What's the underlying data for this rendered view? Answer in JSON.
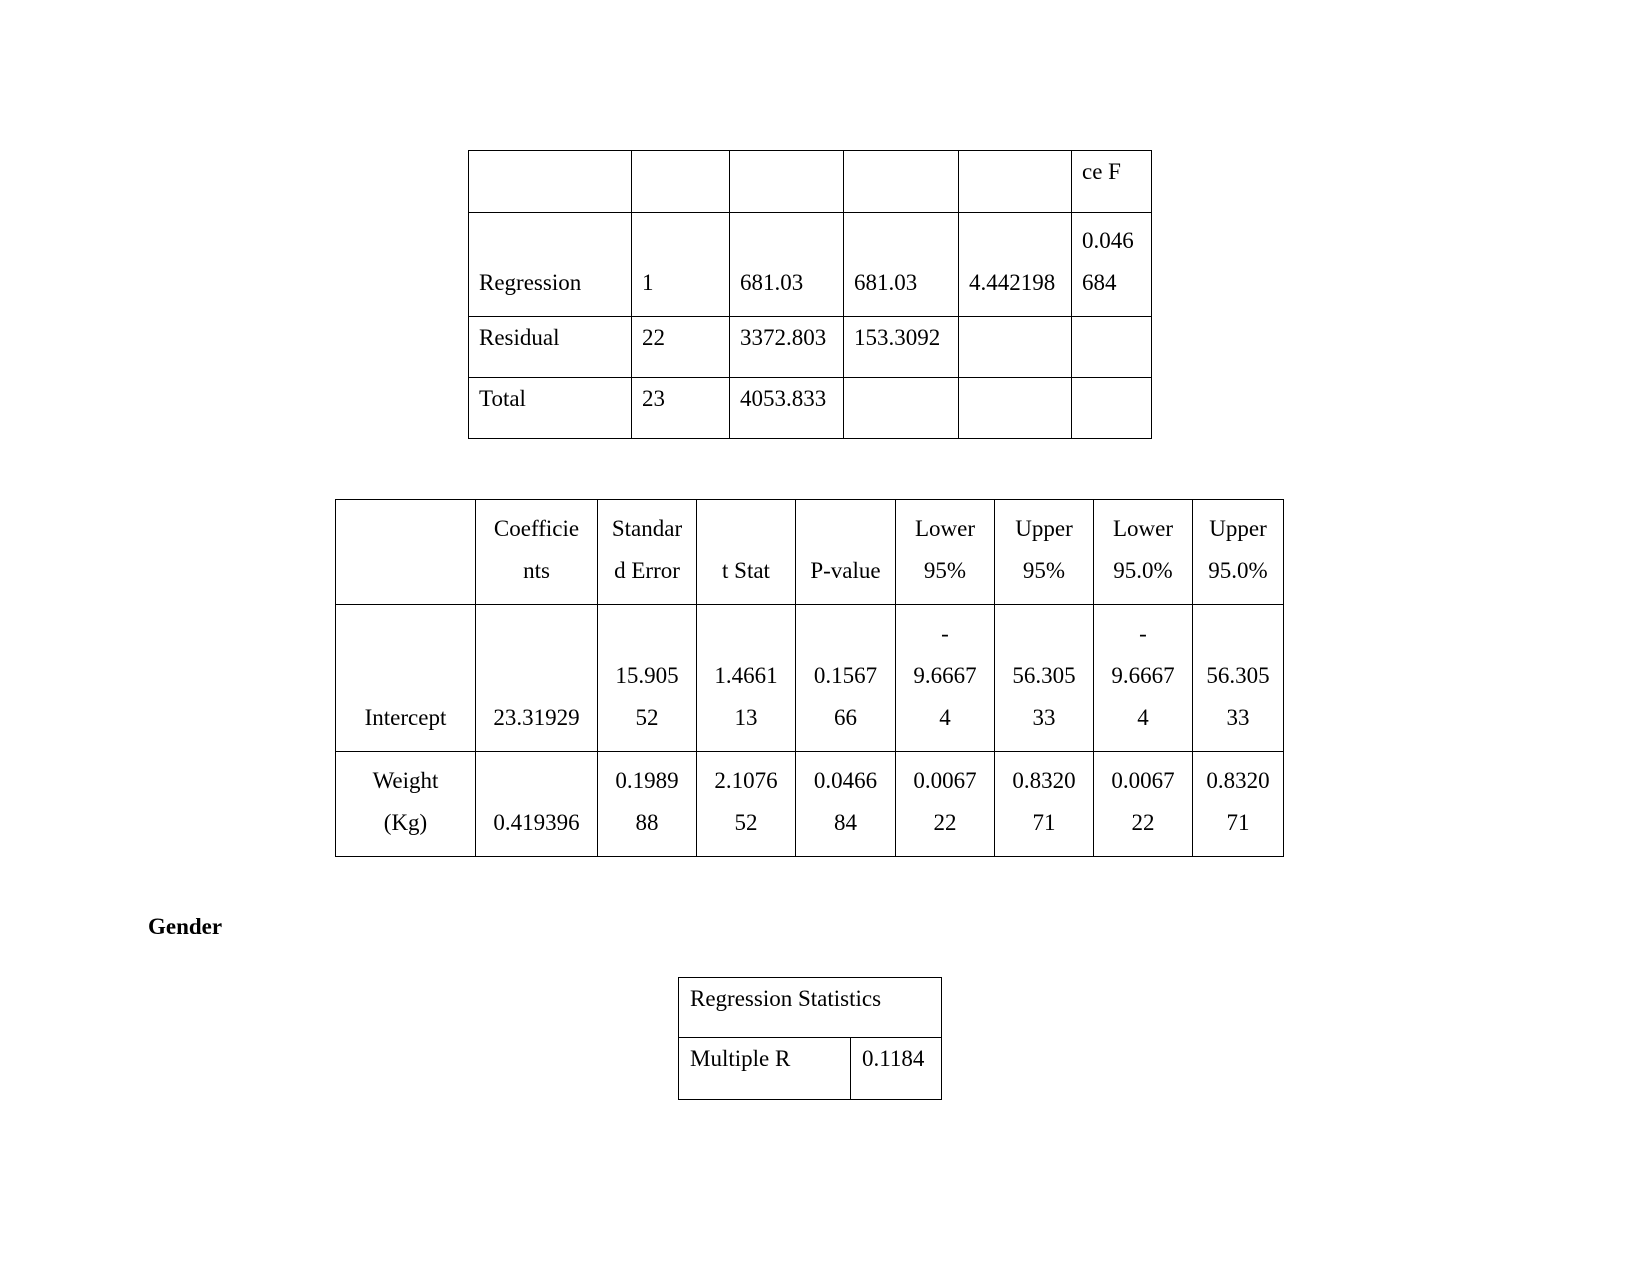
{
  "anova_table": {
    "rows": [
      [
        "",
        "",
        "",
        "",
        "",
        "ce F"
      ],
      [
        "Regression",
        "1",
        "681.03",
        "681.03",
        "4.442198",
        "0.046\n684"
      ],
      [
        "Residual",
        "22",
        "3372.803",
        "153.3092",
        "",
        ""
      ],
      [
        "Total",
        "23",
        "4053.833",
        "",
        "",
        ""
      ]
    ]
  },
  "coefficients_table": {
    "rows": [
      [
        "",
        "Coefficie\nnts",
        "Standar\nd Error",
        "t Stat",
        "P-value",
        "Lower\n95%",
        "Upper\n95%",
        "Lower\n95.0%",
        "Upper\n95.0%"
      ],
      [
        "Intercept",
        "23.31929",
        "15.905\n52",
        "1.4661\n13",
        "0.1567\n66",
        "-\n9.6667\n4",
        "56.305\n33",
        "-\n9.6667\n4",
        "56.305\n33"
      ],
      [
        "Weight\n(Kg)",
        "0.419396",
        "0.1989\n88",
        "2.1076\n52",
        "0.0466\n84",
        "0.0067\n22",
        "0.8320\n71",
        "0.0067\n22",
        "0.8320\n71"
      ]
    ]
  },
  "section_heading": "Gender",
  "regression_statistics_table": {
    "header": "Regression Statistics",
    "rows": [
      [
        "Multiple R",
        "0.1184"
      ]
    ]
  }
}
